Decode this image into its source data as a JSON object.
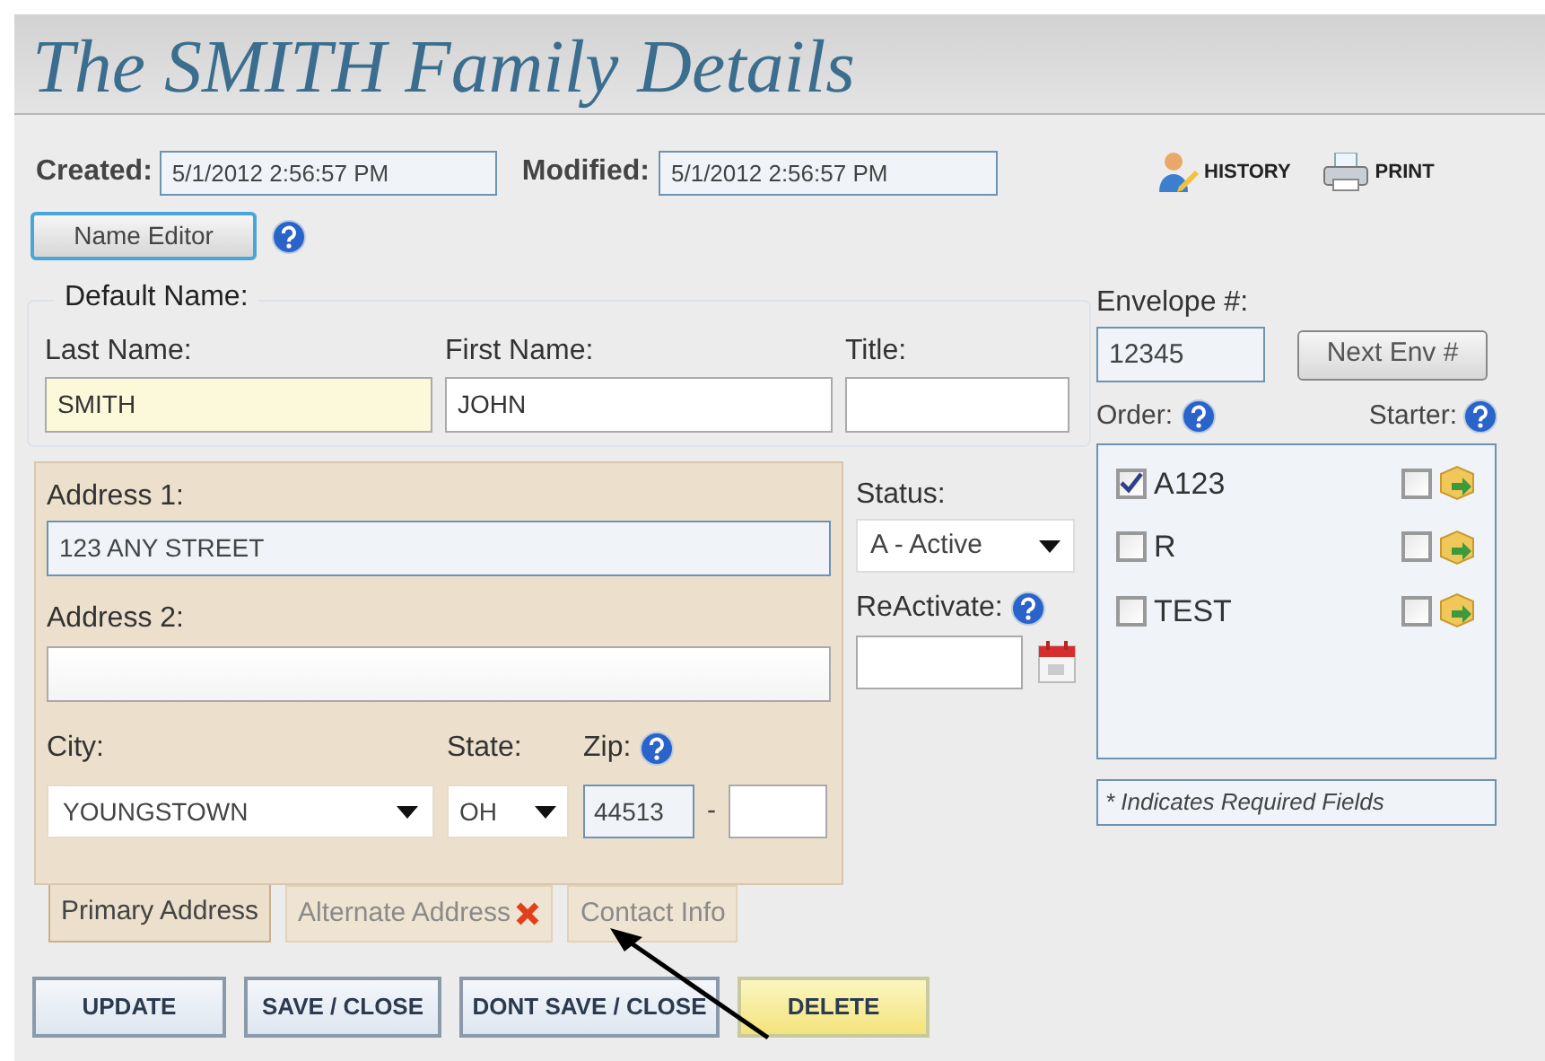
{
  "title": "The SMITH Family Details",
  "created": {
    "label": "Created:",
    "value": "5/1/2012 2:56:57 PM"
  },
  "modified": {
    "label": "Modified:",
    "value": "5/1/2012 2:56:57 PM"
  },
  "actions": [
    {
      "label": "HISTORY",
      "kind": "history"
    },
    {
      "label": "PRINT",
      "kind": "print"
    }
  ],
  "name_editor_button": "Name Editor",
  "default_name": {
    "legend": "Default Name:",
    "fields": [
      {
        "label": "Last Name:",
        "value": "SMITH",
        "highlighted": true
      },
      {
        "label": "First Name:",
        "value": "JOHN",
        "highlighted": false
      },
      {
        "label": "Title:",
        "highlighted": false
      }
    ]
  },
  "address": {
    "address1": {
      "label": "Address 1:",
      "value": "123 ANY STREET"
    },
    "address2": {
      "label": "Address 2:"
    },
    "city": {
      "label": "City:",
      "value": "YOUNGSTOWN"
    },
    "state": {
      "label": "State:",
      "value": "OH"
    },
    "zip": {
      "label": "Zip:",
      "value": "44513",
      "separator": "-"
    }
  },
  "tabs": [
    {
      "label": "Primary Address",
      "selected": true,
      "marked": false
    },
    {
      "label": "Alternate Address",
      "selected": false,
      "marked": true
    },
    {
      "label": "Contact Info",
      "selected": false,
      "marked": false
    }
  ],
  "status": {
    "label": "Status:",
    "value": "A - Active"
  },
  "reactivate": {
    "label": "ReActivate:"
  },
  "envelope": {
    "label": "Envelope #:",
    "value": "12345",
    "button": "Next Env #"
  },
  "order_label": "Order:",
  "starter_label": "Starter:",
  "orders": [
    {
      "label": "A123",
      "checked": true,
      "starter_checked": false
    },
    {
      "label": "R",
      "checked": false,
      "starter_checked": false
    },
    {
      "label": "TEST",
      "checked": false,
      "starter_checked": false
    }
  ],
  "note": "* Indicates Required Fields",
  "buttons": [
    {
      "label": "UPDATE",
      "kind": "normal"
    },
    {
      "label": "SAVE / CLOSE",
      "kind": "normal"
    },
    {
      "label": "DONT SAVE / CLOSE",
      "kind": "normal"
    },
    {
      "label": "DELETE",
      "kind": "warning"
    }
  ]
}
